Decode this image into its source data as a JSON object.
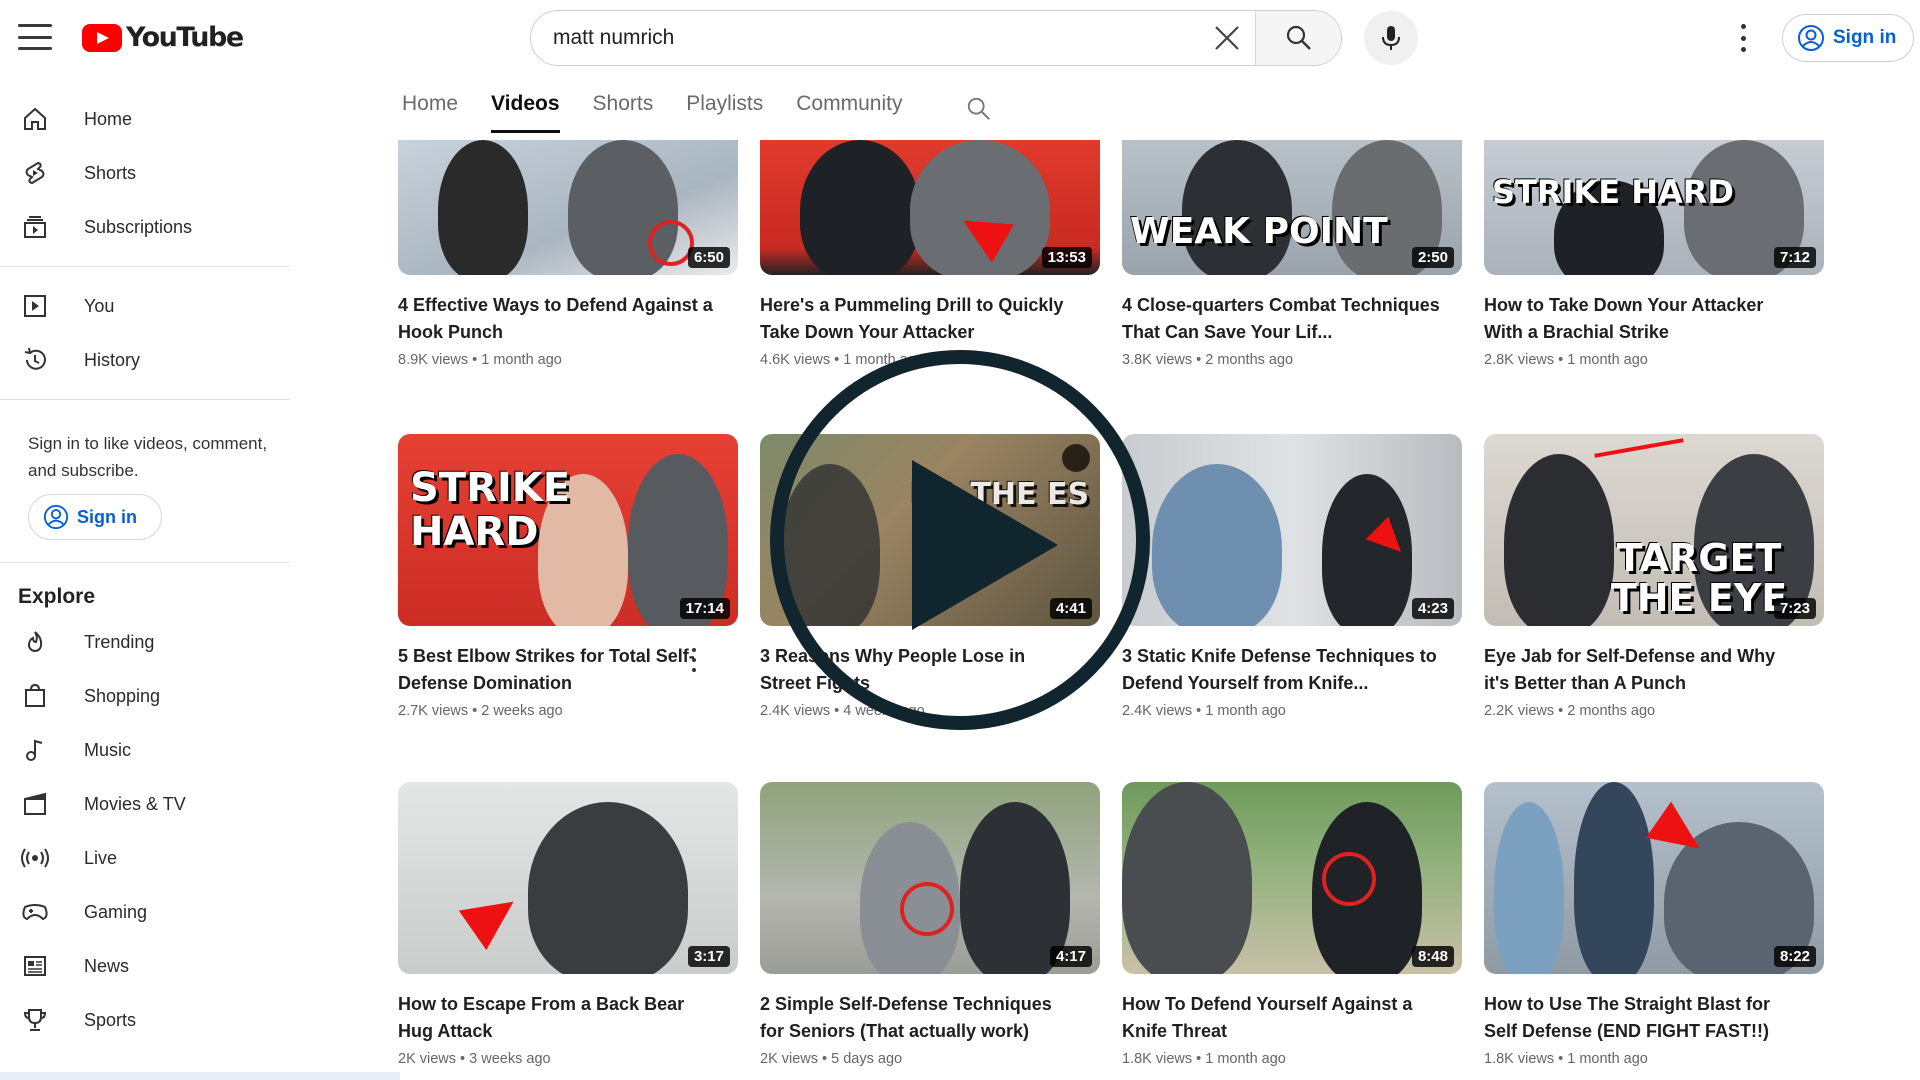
{
  "header": {
    "logo_text": "YouTube",
    "search_value": "matt numrich",
    "sign_in": "Sign in"
  },
  "sidebar": {
    "main": [
      {
        "label": "Home",
        "icon": "home-icon"
      },
      {
        "label": "Shorts",
        "icon": "shorts-icon"
      },
      {
        "label": "Subscriptions",
        "icon": "subscriptions-icon"
      }
    ],
    "you": [
      {
        "label": "You",
        "icon": "you-icon"
      },
      {
        "label": "History",
        "icon": "history-icon"
      }
    ],
    "signin_prompt": "Sign in to like videos, comment, and subscribe.",
    "signin_button": "Sign in",
    "explore_heading": "Explore",
    "explore": [
      {
        "label": "Trending",
        "icon": "trending-icon"
      },
      {
        "label": "Shopping",
        "icon": "shopping-icon"
      },
      {
        "label": "Music",
        "icon": "music-icon"
      },
      {
        "label": "Movies & TV",
        "icon": "movies-icon"
      },
      {
        "label": "Live",
        "icon": "live-icon"
      },
      {
        "label": "Gaming",
        "icon": "gaming-icon"
      },
      {
        "label": "News",
        "icon": "news-icon"
      },
      {
        "label": "Sports",
        "icon": "sports-icon"
      }
    ]
  },
  "tabs": [
    "Home",
    "Videos",
    "Shorts",
    "Playlists",
    "Community"
  ],
  "active_tab": "Videos",
  "videos": [
    {
      "title": "4 Effective Ways to Defend Against a Hook Punch",
      "meta": "8.9K views • 1 month ago",
      "duration": "6:50",
      "overlay": "",
      "bg": "#b9c3cf"
    },
    {
      "title": "Here's a Pummeling Drill to Quickly Take Down Your Attacker",
      "meta": "4.6K views • 1 month ago",
      "duration": "13:53",
      "overlay": "",
      "bg": "#d93a2e"
    },
    {
      "title": "4 Close-quarters Combat Techniques That Can Save Your Lif...",
      "meta": "3.8K views • 2 months ago",
      "duration": "2:50",
      "overlay": "WEAK POINT",
      "bg": "#aeb6bf"
    },
    {
      "title": "How to Take Down Your Attacker With a Brachial Strike",
      "meta": "2.8K views • 1 month ago",
      "duration": "7:12",
      "overlay": "STRIKE HARD",
      "bg": "#b8bec6"
    },
    {
      "title": "5 Best Elbow Strikes for Total Self-Defense Domination",
      "meta": "2.7K views • 2 weeks ago",
      "duration": "17:14",
      "overlay": "STRIKE HARD",
      "bg": "#dd3b30"
    },
    {
      "title": "3 Reasons Why People Lose in Street Fights",
      "meta": "2.4K views • 4 weeks ago",
      "duration": "4:41",
      "overlay": "ND THE ES",
      "bg": "#8a7f66"
    },
    {
      "title": "3 Static Knife Defense Techniques to Defend Yourself from Knife...",
      "meta": "2.4K views • 1 month ago",
      "duration": "4:23",
      "overlay": "",
      "bg": "#c3c8cc"
    },
    {
      "title": "Eye Jab for Self-Defense and Why it's Better than A Punch",
      "meta": "2.2K views • 2 months ago",
      "duration": "7:23",
      "overlay": "TARGET THE EYE",
      "bg": "#c7c4be"
    },
    {
      "title": "How to Escape From a Back Bear Hug Attack",
      "meta": "2K views • 3 weeks ago",
      "duration": "3:17",
      "overlay": "",
      "bg": "#d6d8d6"
    },
    {
      "title": "2 Simple Self-Defense Techniques for Seniors (That actually work)",
      "meta": "2K views • 5 days ago",
      "duration": "4:17",
      "overlay": "",
      "bg": "#9fae8e"
    },
    {
      "title": "How To Defend Yourself Against a Knife Threat",
      "meta": "1.8K views • 1 month ago",
      "duration": "8:48",
      "overlay": "",
      "bg": "#7fa36c"
    },
    {
      "title": "How to Use The Straight Blast for Self Defense (END FIGHT FAST!!)",
      "meta": "1.8K views • 1 month ago",
      "duration": "8:22",
      "overlay": "",
      "bg": "#9aa7b4"
    }
  ],
  "colors": {
    "brand": "#ff0000",
    "link": "#065fd4",
    "overlay_play": "#11252e"
  }
}
